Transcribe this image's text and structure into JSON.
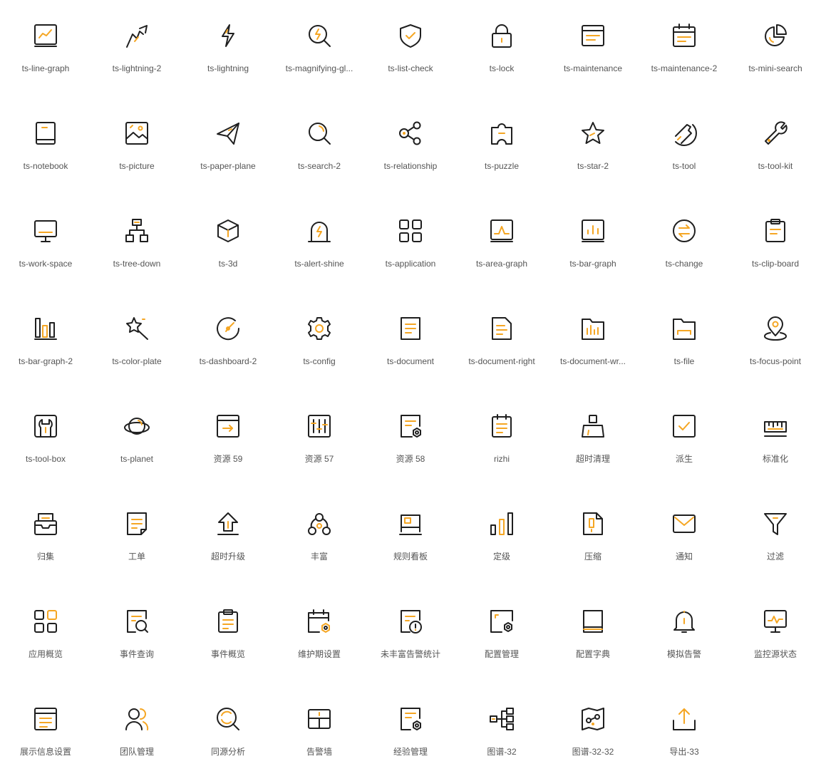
{
  "colors": {
    "stroke": "#1f1f1f",
    "accent": "#f5a623",
    "label": "#555555"
  },
  "icons": [
    {
      "label": "ts-line-graph",
      "icon": "line-graph"
    },
    {
      "label": "ts-lightning-2",
      "icon": "lightning-2"
    },
    {
      "label": "ts-lightning",
      "icon": "lightning"
    },
    {
      "label": "ts-magnifying-gl...",
      "icon": "magnifying-glass"
    },
    {
      "label": "ts-list-check",
      "icon": "list-check"
    },
    {
      "label": "ts-lock",
      "icon": "lock"
    },
    {
      "label": "ts-maintenance",
      "icon": "maintenance"
    },
    {
      "label": "ts-maintenance-2",
      "icon": "maintenance-2"
    },
    {
      "label": "ts-mini-search",
      "icon": "mini-search"
    },
    {
      "label": "ts-notebook",
      "icon": "notebook"
    },
    {
      "label": "ts-picture",
      "icon": "picture"
    },
    {
      "label": "ts-paper-plane",
      "icon": "paper-plane"
    },
    {
      "label": "ts-search-2",
      "icon": "search-2"
    },
    {
      "label": "ts-relationship",
      "icon": "relationship"
    },
    {
      "label": "ts-puzzle",
      "icon": "puzzle"
    },
    {
      "label": "ts-star-2",
      "icon": "star-2"
    },
    {
      "label": "ts-tool",
      "icon": "tool"
    },
    {
      "label": "ts-tool-kit",
      "icon": "tool-kit"
    },
    {
      "label": "ts-work-space",
      "icon": "work-space"
    },
    {
      "label": "ts-tree-down",
      "icon": "tree-down"
    },
    {
      "label": "ts-3d",
      "icon": "3d"
    },
    {
      "label": "ts-alert-shine",
      "icon": "alert-shine"
    },
    {
      "label": "ts-application",
      "icon": "application"
    },
    {
      "label": "ts-area-graph",
      "icon": "area-graph"
    },
    {
      "label": "ts-bar-graph",
      "icon": "bar-graph"
    },
    {
      "label": "ts-change",
      "icon": "change"
    },
    {
      "label": "ts-clip-board",
      "icon": "clip-board"
    },
    {
      "label": "ts-bar-graph-2",
      "icon": "bar-graph-2"
    },
    {
      "label": "ts-color-plate",
      "icon": "color-plate"
    },
    {
      "label": "ts-dashboard-2",
      "icon": "dashboard-2"
    },
    {
      "label": "ts-config",
      "icon": "config"
    },
    {
      "label": "ts-document",
      "icon": "document"
    },
    {
      "label": "ts-document-right",
      "icon": "document-right"
    },
    {
      "label": "ts-document-wr...",
      "icon": "document-wr"
    },
    {
      "label": "ts-file",
      "icon": "file"
    },
    {
      "label": "ts-focus-point",
      "icon": "focus-point"
    },
    {
      "label": "ts-tool-box",
      "icon": "tool-box"
    },
    {
      "label": "ts-planet",
      "icon": "planet"
    },
    {
      "label": "资源 59",
      "icon": "res-59"
    },
    {
      "label": "资源 57",
      "icon": "res-57"
    },
    {
      "label": "资源 58",
      "icon": "res-58"
    },
    {
      "label": "rizhi",
      "icon": "rizhi"
    },
    {
      "label": "超时清理",
      "icon": "timeout-clean"
    },
    {
      "label": "派生",
      "icon": "derive"
    },
    {
      "label": "标准化",
      "icon": "standardize"
    },
    {
      "label": "归集",
      "icon": "collect"
    },
    {
      "label": "工单",
      "icon": "work-order"
    },
    {
      "label": "超时升级",
      "icon": "timeout-upgrade"
    },
    {
      "label": "丰富",
      "icon": "enrich"
    },
    {
      "label": "规则看板",
      "icon": "rule-board"
    },
    {
      "label": "定级",
      "icon": "grading"
    },
    {
      "label": "压缩",
      "icon": "compress"
    },
    {
      "label": "通知",
      "icon": "notify"
    },
    {
      "label": "过滤",
      "icon": "filter"
    },
    {
      "label": "应用概览",
      "icon": "app-overview"
    },
    {
      "label": "事件查询",
      "icon": "event-query"
    },
    {
      "label": "事件概览",
      "icon": "event-overview"
    },
    {
      "label": "维护期设置",
      "icon": "maintenance-settings"
    },
    {
      "label": "未丰富告警统计",
      "icon": "unenriched-alert-stats"
    },
    {
      "label": "配置管理",
      "icon": "config-manage"
    },
    {
      "label": "配置字典",
      "icon": "config-dict"
    },
    {
      "label": "模拟告警",
      "icon": "mock-alert"
    },
    {
      "label": "监控源状态",
      "icon": "monitor-source-status"
    },
    {
      "label": "展示信息设置",
      "icon": "display-info-settings"
    },
    {
      "label": "团队管理",
      "icon": "team-manage"
    },
    {
      "label": "同源分析",
      "icon": "same-source-analysis"
    },
    {
      "label": "告警墙",
      "icon": "alert-wall"
    },
    {
      "label": "经验管理",
      "icon": "experience-manage"
    },
    {
      "label": "图谱-32",
      "icon": "graph-32"
    },
    {
      "label": "图谱-32-32",
      "icon": "graph-32-32"
    },
    {
      "label": "导出-33",
      "icon": "export-33"
    }
  ]
}
